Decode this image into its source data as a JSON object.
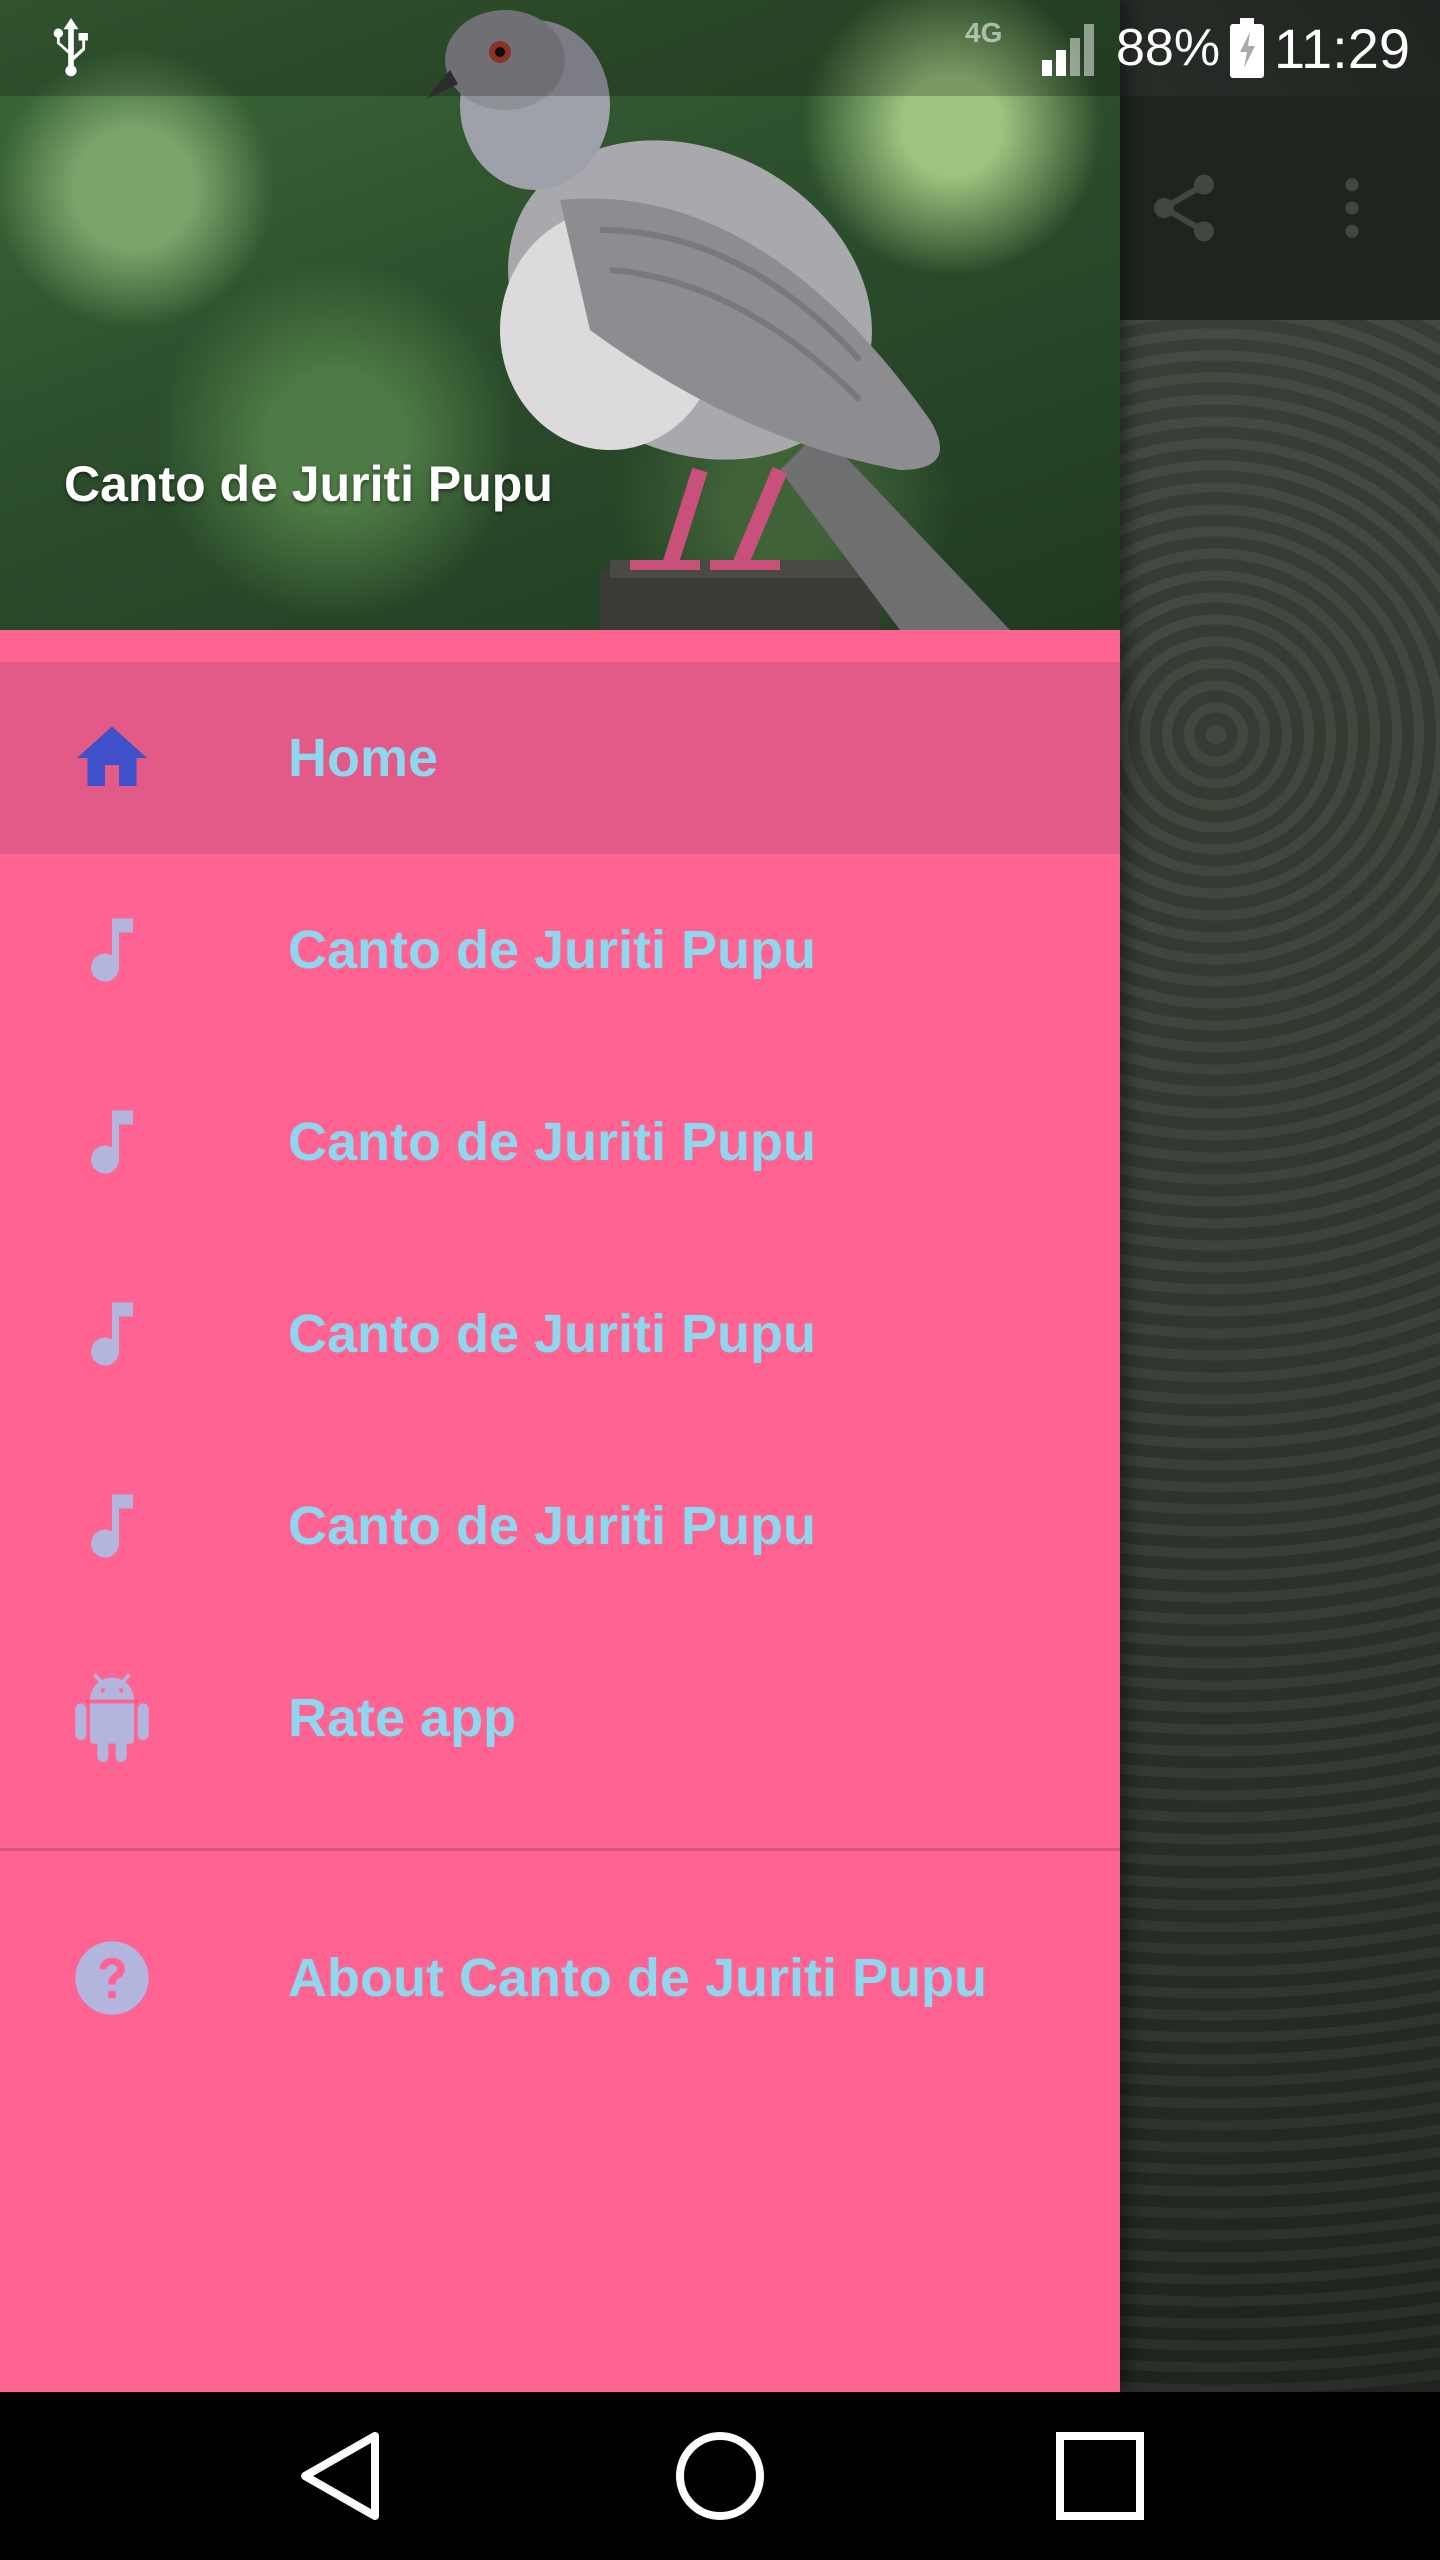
{
  "status_bar": {
    "battery": "88%",
    "time": "11:29",
    "network_label": "4G"
  },
  "toolbar": {
    "share_icon": "share-icon",
    "overflow_icon": "more-vert-icon"
  },
  "drawer": {
    "header_title": "Canto de Juriti Pupu",
    "items": [
      {
        "label": "Home",
        "icon": "home-icon",
        "active": true
      },
      {
        "label": "Canto de Juriti Pupu",
        "icon": "music-note-icon"
      },
      {
        "label": "Canto de Juriti Pupu",
        "icon": "music-note-icon"
      },
      {
        "label": "Canto de Juriti Pupu",
        "icon": "music-note-icon"
      },
      {
        "label": "Canto de Juriti Pupu",
        "icon": "music-note-icon"
      },
      {
        "label": "Rate app",
        "icon": "android-icon"
      }
    ],
    "footer_items": [
      {
        "label": "About Canto de Juriti Pupu",
        "icon": "help-circle-icon"
      }
    ]
  },
  "colors": {
    "drawer_bg": "#ff6392",
    "active_item_bg": "#e35987",
    "label_color": "#8fd7ef",
    "home_icon_color": "#3f51c8",
    "icon_color": "#b3b5de"
  }
}
